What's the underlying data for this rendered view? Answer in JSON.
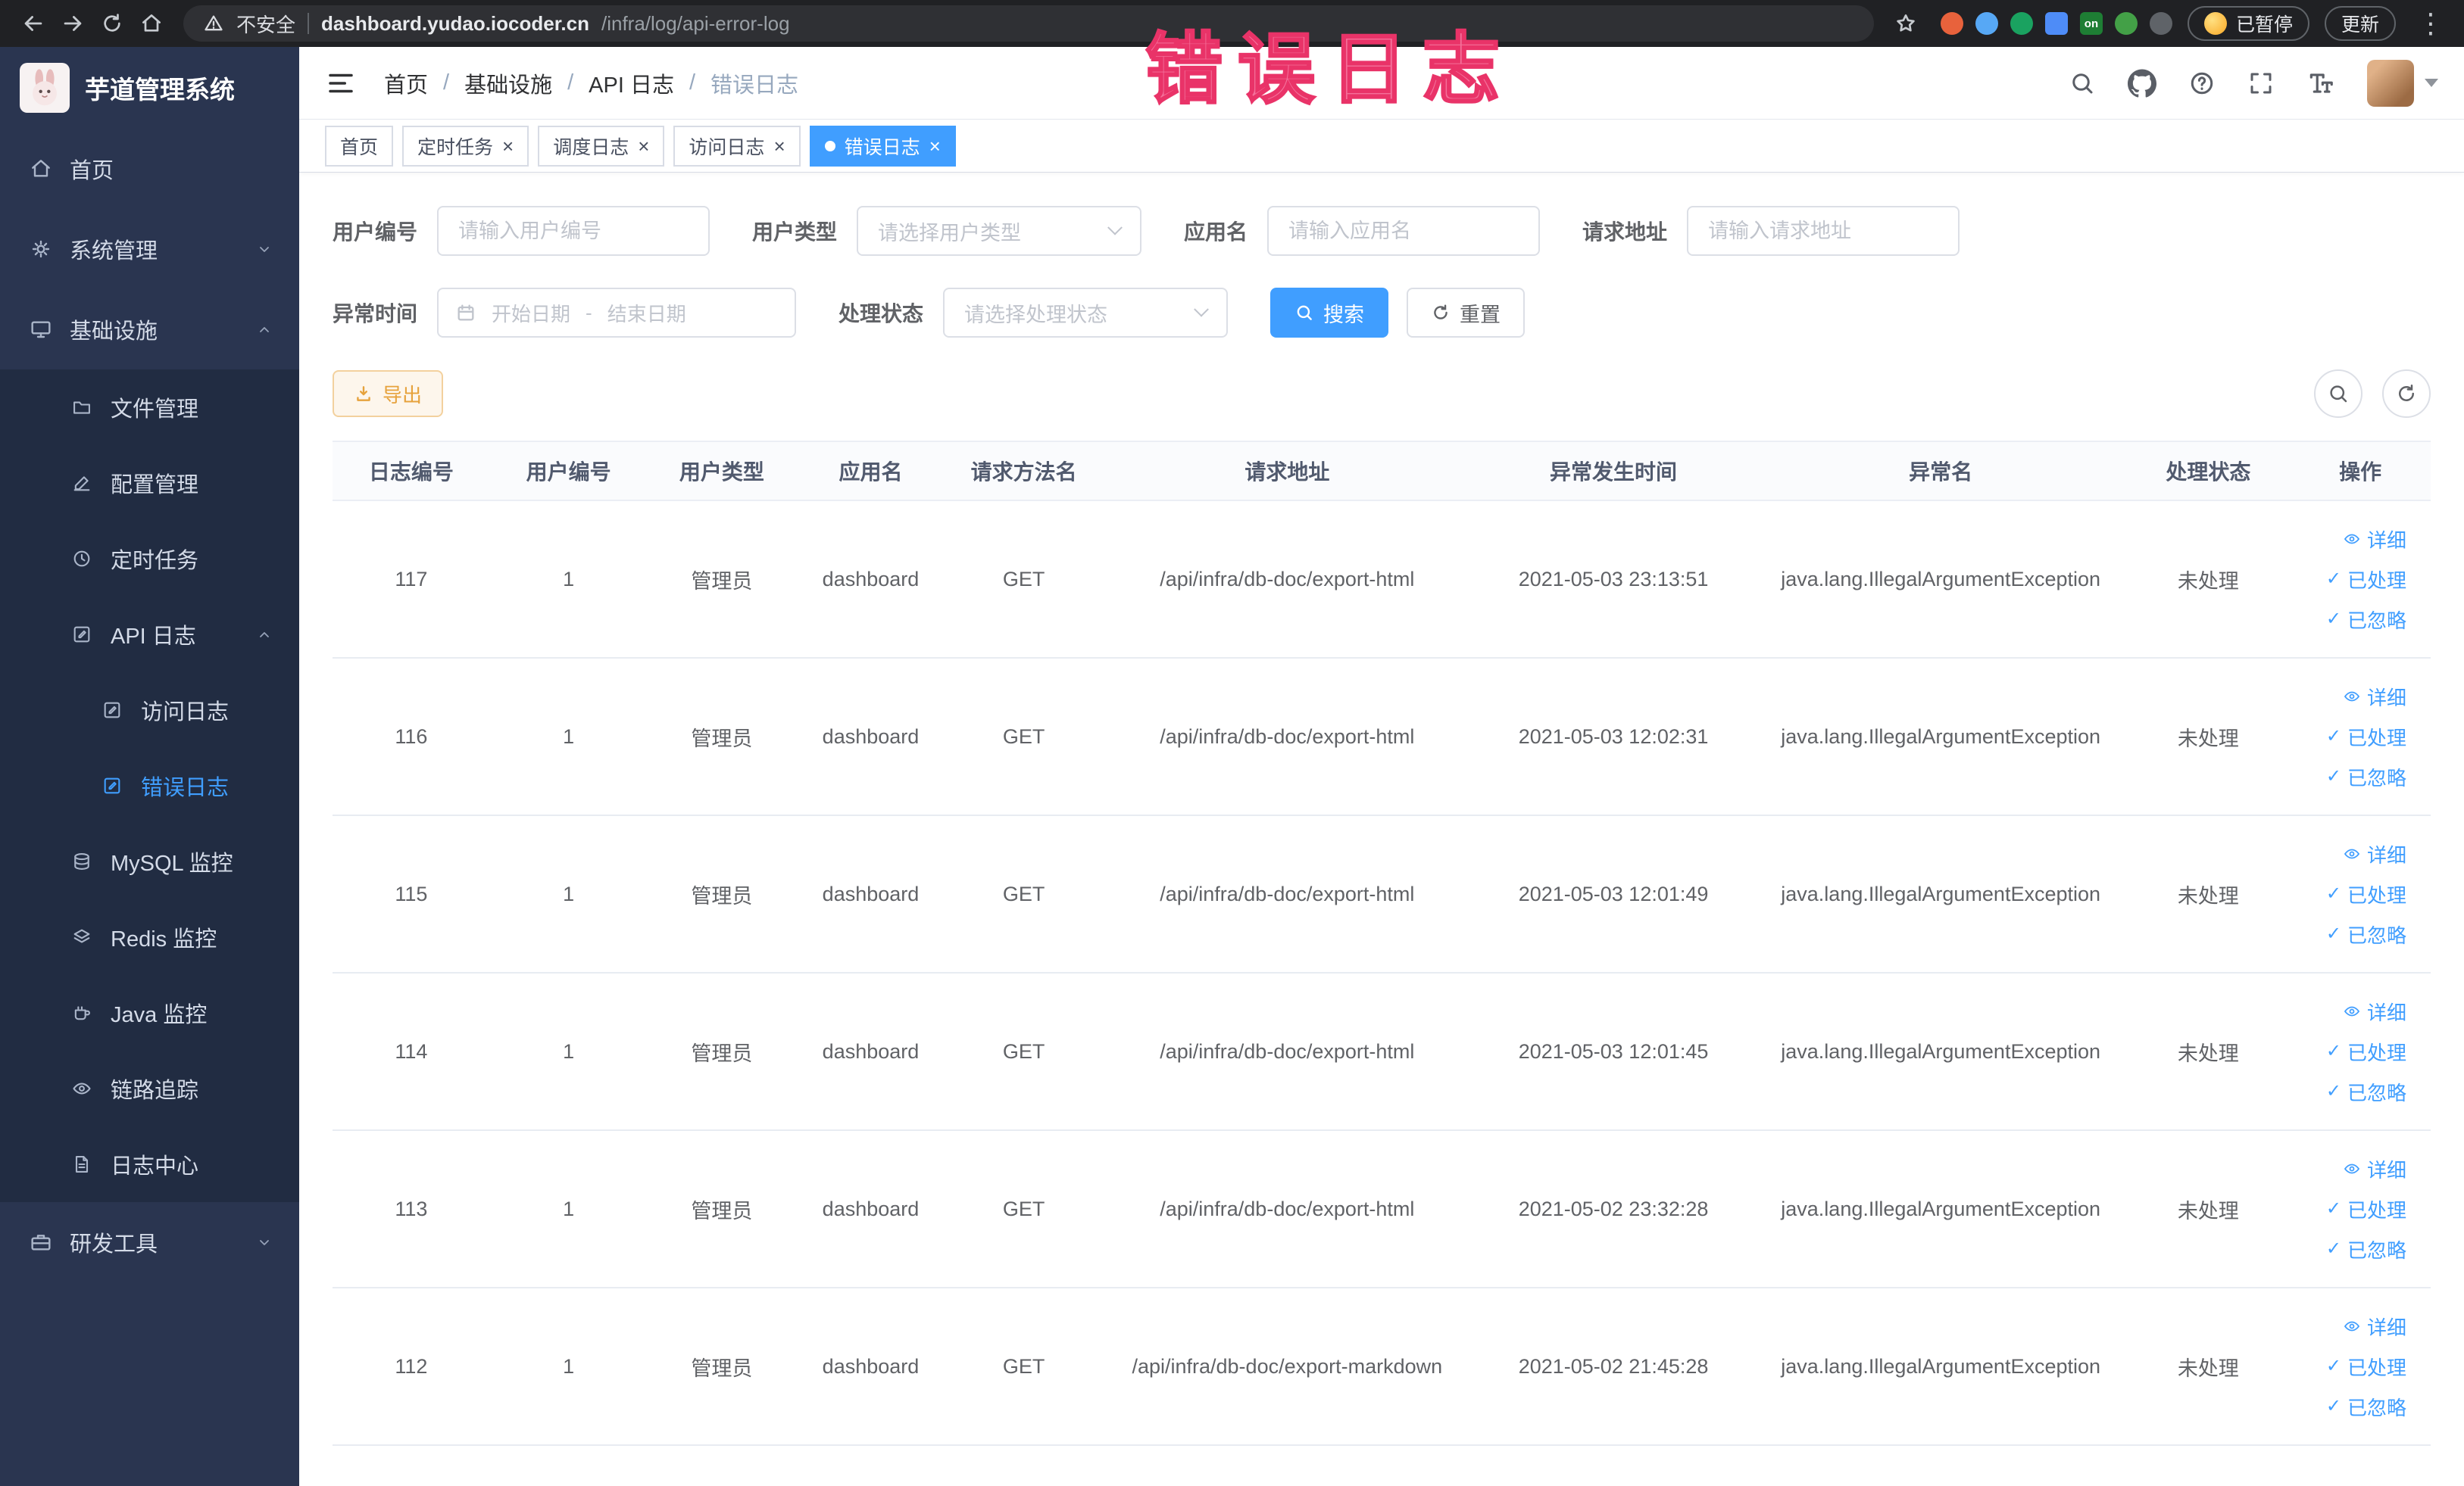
{
  "browser": {
    "security_label": "不安全",
    "url_domain": "dashboard.yudao.iocoder.cn",
    "url_path": "/infra/log/api-error-log",
    "paused_badge": "已暂停",
    "update_label": "更新",
    "extensions": [
      {
        "name": "adblock-icon",
        "color": "#e8623c",
        "shape": "circle"
      },
      {
        "name": "drop-icon",
        "color": "#57a8f5",
        "shape": "circle"
      },
      {
        "name": "green-circle-icon",
        "color": "#1aa260",
        "shape": "circle"
      },
      {
        "name": "grid-icon",
        "color": "#4e8cf7",
        "shape": "square"
      },
      {
        "name": "on-badge-icon",
        "color": "#1e7e34",
        "shape": "square",
        "text": "on"
      },
      {
        "name": "leaf-icon",
        "color": "#43a047",
        "shape": "circle"
      },
      {
        "name": "paw-icon",
        "color": "#5f6368",
        "shape": "circle"
      }
    ]
  },
  "annotation": {
    "text": "错误日志"
  },
  "sidebar": {
    "title": "芋道管理系统",
    "items": [
      {
        "name": "home",
        "label": "首页",
        "icon": "home",
        "level": 1
      },
      {
        "name": "system",
        "label": "系统管理",
        "icon": "gear",
        "level": 1,
        "chevron": "down"
      },
      {
        "name": "infra",
        "label": "基础设施",
        "icon": "monitor",
        "level": 1,
        "chevron": "up"
      },
      {
        "name": "file-manage",
        "label": "文件管理",
        "icon": "folder",
        "level": 2
      },
      {
        "name": "config-manage",
        "label": "配置管理",
        "icon": "edit",
        "level": 2
      },
      {
        "name": "scheduled-job",
        "label": "定时任务",
        "icon": "clock",
        "level": 2
      },
      {
        "name": "api-log",
        "label": "API 日志",
        "icon": "edit-square",
        "level": 2,
        "chevron": "up"
      },
      {
        "name": "access-log",
        "label": "访问日志",
        "icon": "edit-square",
        "level": 3
      },
      {
        "name": "error-log",
        "label": "错误日志",
        "icon": "edit-square",
        "level": 3,
        "active": true
      },
      {
        "name": "mysql-monitor",
        "label": "MySQL 监控",
        "icon": "database",
        "level": 2
      },
      {
        "name": "redis-monitor",
        "label": "Redis 监控",
        "icon": "layers",
        "level": 2
      },
      {
        "name": "java-monitor",
        "label": "Java 监控",
        "icon": "coffee",
        "level": 2
      },
      {
        "name": "trace",
        "label": "链路追踪",
        "icon": "eye",
        "level": 2
      },
      {
        "name": "log-center",
        "label": "日志中心",
        "icon": "document",
        "level": 2
      },
      {
        "name": "dev-tools",
        "label": "研发工具",
        "icon": "toolbox",
        "level": 1,
        "chevron": "down"
      }
    ]
  },
  "header": {
    "breadcrumb": [
      "首页",
      "基础设施",
      "API 日志",
      "错误日志"
    ]
  },
  "tabs": [
    {
      "name": "home",
      "label": "首页"
    },
    {
      "name": "scheduled-job",
      "label": "定时任务",
      "closable": true
    },
    {
      "name": "job-log",
      "label": "调度日志",
      "closable": true
    },
    {
      "name": "access-log",
      "label": "访问日志",
      "closable": true
    },
    {
      "name": "error-log",
      "label": "错误日志",
      "closable": true,
      "active": true
    }
  ],
  "filters": {
    "user_id": {
      "label": "用户编号",
      "placeholder": "请输入用户编号"
    },
    "user_type": {
      "label": "用户类型",
      "placeholder": "请选择用户类型"
    },
    "app_name": {
      "label": "应用名",
      "placeholder": "请输入应用名"
    },
    "request_url": {
      "label": "请求地址",
      "placeholder": "请输入请求地址"
    },
    "exception_time": {
      "label": "异常时间",
      "start_placeholder": "开始日期",
      "separator": "-",
      "end_placeholder": "结束日期"
    },
    "process_status": {
      "label": "处理状态",
      "placeholder": "请选择处理状态"
    },
    "search_label": "搜索",
    "reset_label": "重置"
  },
  "toolbar": {
    "export_label": "导出"
  },
  "table": {
    "columns": [
      "日志编号",
      "用户编号",
      "用户类型",
      "应用名",
      "请求方法名",
      "请求地址",
      "异常发生时间",
      "异常名",
      "处理状态",
      "操作"
    ],
    "row_actions": [
      "详细",
      "已处理",
      "已忽略"
    ],
    "rows": [
      {
        "cells": [
          "117",
          "1",
          "管理员",
          "dashboard",
          "GET",
          "/api/infra/db-doc/export-html",
          "2021-05-03 23:13:51",
          "java.lang.IllegalArgumentException",
          "未处理"
        ]
      },
      {
        "cells": [
          "116",
          "1",
          "管理员",
          "dashboard",
          "GET",
          "/api/infra/db-doc/export-html",
          "2021-05-03 12:02:31",
          "java.lang.IllegalArgumentException",
          "未处理"
        ]
      },
      {
        "cells": [
          "115",
          "1",
          "管理员",
          "dashboard",
          "GET",
          "/api/infra/db-doc/export-html",
          "2021-05-03 12:01:49",
          "java.lang.IllegalArgumentException",
          "未处理"
        ]
      },
      {
        "cells": [
          "114",
          "1",
          "管理员",
          "dashboard",
          "GET",
          "/api/infra/db-doc/export-html",
          "2021-05-03 12:01:45",
          "java.lang.IllegalArgumentException",
          "未处理"
        ]
      },
      {
        "cells": [
          "113",
          "1",
          "管理员",
          "dashboard",
          "GET",
          "/api/infra/db-doc/export-html",
          "2021-05-02 23:32:28",
          "java.lang.IllegalArgumentException",
          "未处理"
        ]
      },
      {
        "cells": [
          "112",
          "1",
          "管理员",
          "dashboard",
          "GET",
          "/api/infra/db-doc/export-markdown",
          "2021-05-02 21:45:28",
          "java.lang.IllegalArgumentException",
          "未处理"
        ]
      }
    ]
  }
}
